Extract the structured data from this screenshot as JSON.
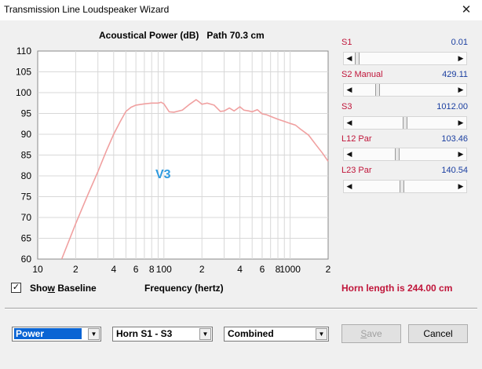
{
  "window": {
    "title": "Transmission Line Loudspeaker Wizard",
    "close_glyph": "✕"
  },
  "chart_header": {
    "title": "Acoustical Power (dB)",
    "path": "Path 70.3 cm"
  },
  "chart_annotation": "V3",
  "chart_data": {
    "type": "line",
    "title": "Acoustical Power (dB)   Path 70.3 cm",
    "xlabel": "Frequency (hertz)",
    "ylabel": "",
    "xscale": "log",
    "xlim": [
      10,
      2000
    ],
    "ylim": [
      60,
      110
    ],
    "y_ticks": [
      60,
      65,
      70,
      75,
      80,
      85,
      90,
      95,
      100,
      105,
      110
    ],
    "x_tick_labels": [
      {
        "x": 10,
        "label": "10"
      },
      {
        "x": 20,
        "label": "2"
      },
      {
        "x": 40,
        "label": "4"
      },
      {
        "x": 60,
        "label": "6"
      },
      {
        "x": 80,
        "label": "8"
      },
      {
        "x": 100,
        "label": "100"
      },
      {
        "x": 200,
        "label": "2"
      },
      {
        "x": 400,
        "label": "4"
      },
      {
        "x": 600,
        "label": "6"
      },
      {
        "x": 800,
        "label": "8"
      },
      {
        "x": 1000,
        "label": "1000"
      },
      {
        "x": 2000,
        "label": "2"
      }
    ],
    "grid": true,
    "series": [
      {
        "color": "#f0a0a0",
        "x": [
          15.5,
          20,
          25,
          30,
          35,
          40,
          45,
          50,
          55,
          60,
          70,
          80,
          90,
          95,
          100,
          110,
          120,
          140,
          160,
          180,
          190,
          200,
          220,
          250,
          280,
          300,
          330,
          360,
          400,
          430,
          470,
          500,
          550,
          600,
          650,
          700,
          800,
          900,
          1000,
          1100,
          1200,
          1400,
          1600,
          1800,
          2000
        ],
        "y": [
          60,
          68.5,
          75.5,
          81,
          86,
          90,
          93,
          95.5,
          96.5,
          97,
          97.3,
          97.5,
          97.5,
          97.7,
          97.3,
          95.4,
          95.3,
          95.8,
          97.2,
          98.3,
          97.8,
          97.2,
          97.5,
          97.0,
          95.5,
          95.6,
          96.3,
          95.6,
          96.6,
          95.8,
          95.6,
          95.4,
          95.9,
          94.9,
          94.7,
          94.3,
          93.6,
          93.1,
          92.6,
          92.2,
          91.3,
          89.8,
          87.5,
          85.5,
          83.5
        ]
      }
    ]
  },
  "sliders": [
    {
      "label": "S1",
      "value": "0.01",
      "level": 0.0
    },
    {
      "label": "S2  Manual",
      "value": "429.11",
      "level": 0.21
    },
    {
      "label": "S3",
      "value": "1012.00",
      "level": 0.5
    },
    {
      "label": "L12  Par",
      "value": "103.46",
      "level": 0.42
    },
    {
      "label": "L23  Par",
      "value": "140.54",
      "level": 0.47
    }
  ],
  "show_baseline": {
    "checked": true,
    "check_glyph": "✓",
    "label_pre": "Sho",
    "label_u": "w",
    "label_post": " Baseline"
  },
  "xaxis_title": "Frequency (hertz)",
  "horn_length": "Horn length is 244.00 cm",
  "combos": {
    "mode": "Power",
    "horn": "Horn S1 - S3",
    "display": "Combined"
  },
  "buttons": {
    "save_u": "S",
    "save_rest": "ave",
    "cancel": "Cancel"
  }
}
